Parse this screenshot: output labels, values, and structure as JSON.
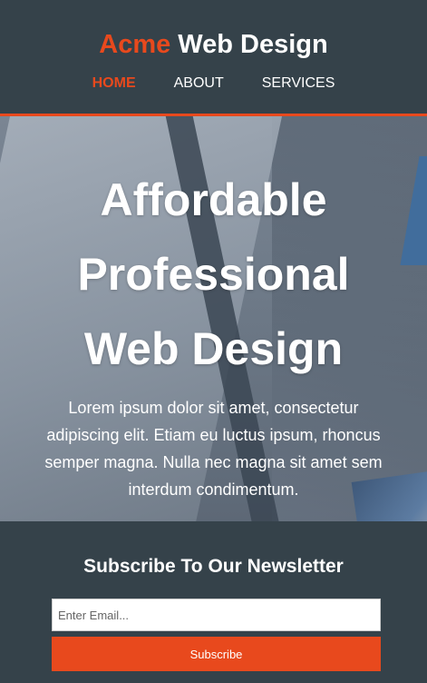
{
  "brand": {
    "accent": "Acme",
    "rest": " Web Design"
  },
  "nav": {
    "home": "HOME",
    "about": "ABOUT",
    "services": "SERVICES"
  },
  "hero": {
    "title_line1": "Affordable",
    "title_line2": "Professional",
    "title_line3": "Web Design",
    "text": "Lorem ipsum dolor sit amet, consectetur adipiscing elit. Etiam eu luctus ipsum, rhoncus semper magna. Nulla nec magna sit amet sem interdum condimentum."
  },
  "newsletter": {
    "heading": "Subscribe To Our Newsletter",
    "email_placeholder": "Enter Email...",
    "email_value": "",
    "button_label": "Subscribe"
  },
  "colors": {
    "primary_dark": "#35424a",
    "accent": "#e8491d",
    "text_light": "#ffffff"
  }
}
